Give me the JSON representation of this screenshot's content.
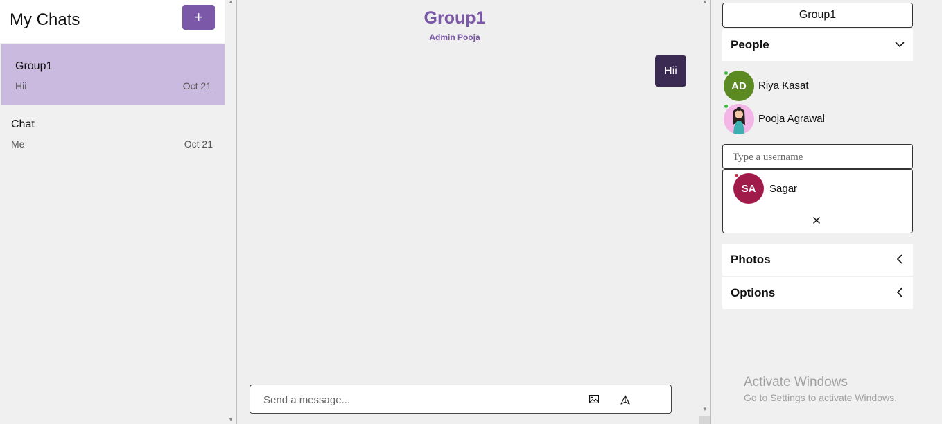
{
  "sidebar": {
    "title": "My Chats",
    "new_chat_label": "+",
    "chats": [
      {
        "name": "Group1",
        "last_message": "Hii",
        "date": "Oct 21",
        "active": true
      },
      {
        "name": "Chat",
        "last_message": "Me",
        "date": "Oct 21",
        "active": false
      }
    ]
  },
  "conversation": {
    "title": "Group1",
    "subtitle": "Admin Pooja",
    "messages": [
      {
        "text": "Hii",
        "from_self": true
      }
    ],
    "composer": {
      "placeholder": "Send a message...",
      "attach_icon": "image-icon",
      "send_icon": "send-icon"
    }
  },
  "details": {
    "group_name": "Group1",
    "people_label": "People",
    "people": [
      {
        "initials": "AD",
        "name": "Riya Kasat",
        "avatar_color": "#5b8a22",
        "online": true
      },
      {
        "initials": "",
        "name": "Pooja Agrawal",
        "avatar_color": "#f3b6e6",
        "online": true
      }
    ],
    "search": {
      "placeholder": "Type a username",
      "results": [
        {
          "initials": "SA",
          "name": "Sagar",
          "avatar_color": "#a01a4a"
        }
      ],
      "close_label": "X"
    },
    "photos_label": "Photos",
    "options_label": "Options"
  },
  "watermark": {
    "line1": "Activate Windows",
    "line2": "Go to Settings to activate Windows."
  },
  "colors": {
    "accent": "#7b58a8",
    "active_chat_bg": "#cbbadf",
    "bubble_bg": "#3b2a52"
  }
}
